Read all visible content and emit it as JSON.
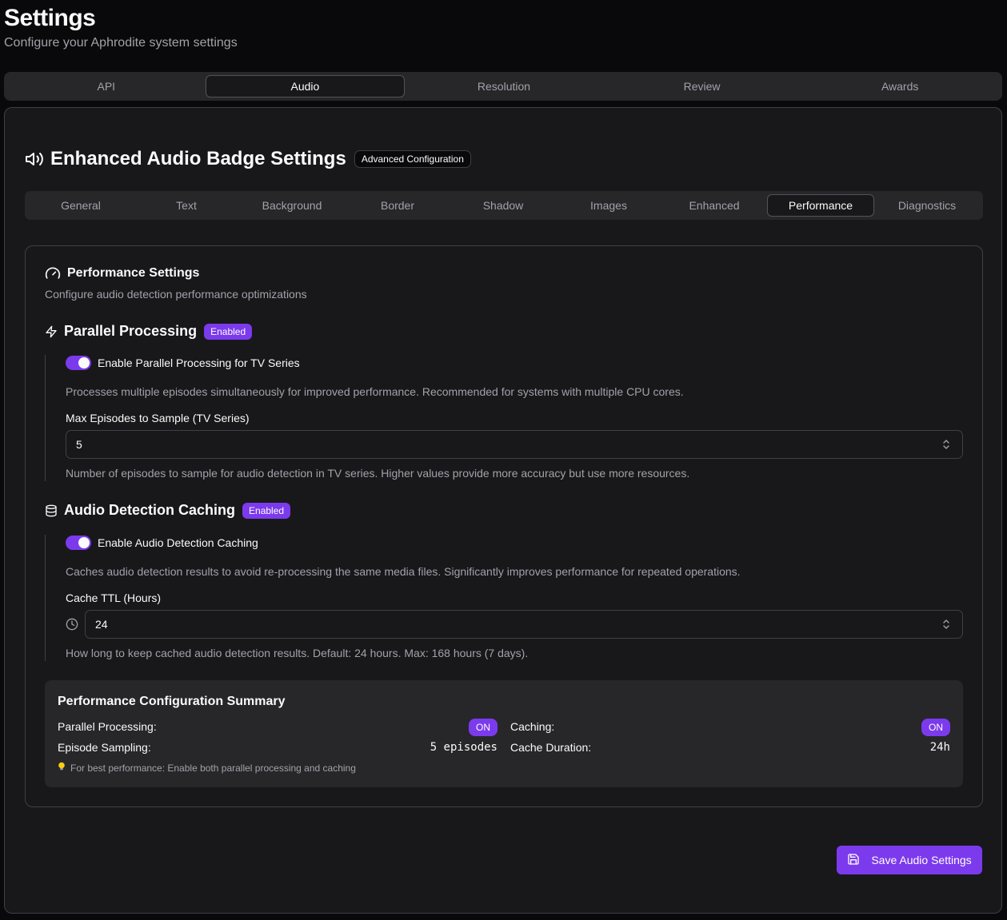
{
  "page": {
    "title": "Settings",
    "subtitle": "Configure your Aphrodite system settings"
  },
  "main_tabs": [
    {
      "label": "API"
    },
    {
      "label": "Audio"
    },
    {
      "label": "Resolution"
    },
    {
      "label": "Review"
    },
    {
      "label": "Awards"
    }
  ],
  "main_tabs_active": "Audio",
  "card": {
    "title": "Enhanced Audio Badge Settings",
    "badge": "Advanced Configuration",
    "icon": "speaker-icon"
  },
  "sub_tabs": [
    {
      "label": "General"
    },
    {
      "label": "Text"
    },
    {
      "label": "Background"
    },
    {
      "label": "Border"
    },
    {
      "label": "Shadow"
    },
    {
      "label": "Images"
    },
    {
      "label": "Enhanced"
    },
    {
      "label": "Performance"
    },
    {
      "label": "Diagnostics"
    }
  ],
  "sub_tabs_active": "Performance",
  "performance": {
    "title": "Performance Settings",
    "description": "Configure audio detection performance optimizations",
    "parallel": {
      "title": "Parallel Processing",
      "badge": "Enabled",
      "toggle_label": "Enable Parallel Processing for TV Series",
      "toggle_on": true,
      "help": "Processes multiple episodes simultaneously for improved performance. Recommended for systems with multiple CPU cores.",
      "field_label": "Max Episodes to Sample (TV Series)",
      "field_value": "5",
      "field_help": "Number of episodes to sample for audio detection in TV series. Higher values provide more accuracy but use more resources."
    },
    "caching": {
      "title": "Audio Detection Caching",
      "badge": "Enabled",
      "toggle_label": "Enable Audio Detection Caching",
      "toggle_on": true,
      "help": "Caches audio detection results to avoid re-processing the same media files. Significantly improves performance for repeated operations.",
      "field_label": "Cache TTL (Hours)",
      "field_value": "24",
      "field_help": "How long to keep cached audio detection results. Default: 24 hours. Max: 168 hours (7 days)."
    },
    "summary": {
      "title": "Performance Configuration Summary",
      "parallel_label": "Parallel Processing:",
      "parallel_value": "ON",
      "caching_label": "Caching:",
      "caching_value": "ON",
      "sampling_label": "Episode Sampling:",
      "sampling_value": "5 episodes",
      "duration_label": "Cache Duration:",
      "duration_value": "24h",
      "tip": "For best performance: Enable both parallel processing and caching"
    }
  },
  "save_button": {
    "label": "Save Audio Settings"
  },
  "colors": {
    "accent": "#7c3aed",
    "background": "#09090b",
    "card": "#18181b",
    "border": "#3f3f46"
  }
}
